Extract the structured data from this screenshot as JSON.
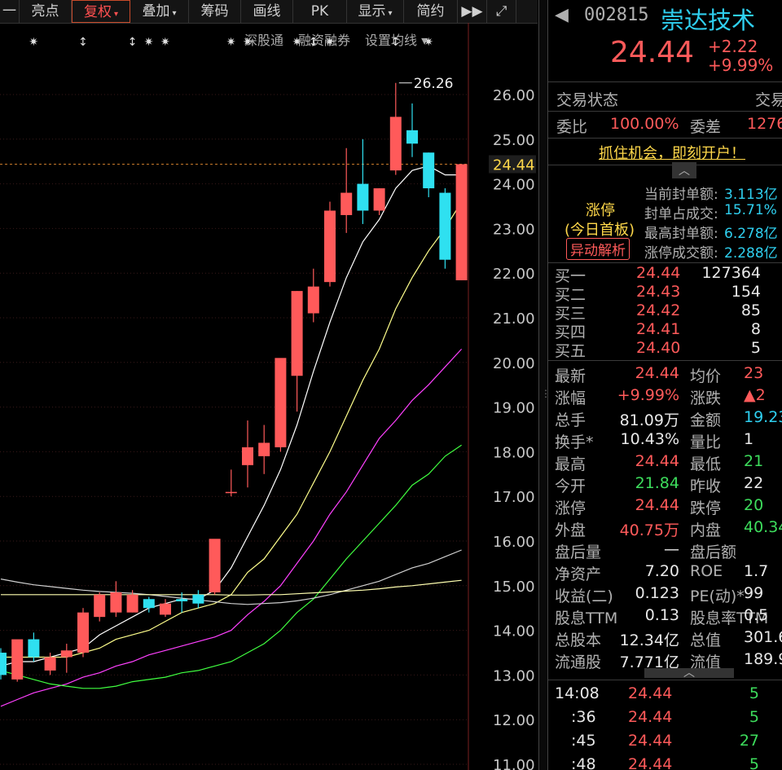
{
  "toolbar": {
    "items": [
      {
        "label": "一",
        "caret": ""
      },
      {
        "label": "亮点",
        "caret": ""
      },
      {
        "label": "复权",
        "caret": "▾"
      },
      {
        "label": "叠加",
        "caret": "▾"
      },
      {
        "label": "筹码",
        "caret": ""
      },
      {
        "label": "画线",
        "caret": ""
      },
      {
        "label": "PK",
        "caret": ""
      },
      {
        "label": "显示",
        "caret": "▾"
      },
      {
        "label": "简约",
        "caret": ""
      },
      {
        "label": "▶▶",
        "caret": ""
      },
      {
        "label": "⤢",
        "caret": ""
      }
    ]
  },
  "subbar": {
    "link1": "深股通",
    "link2": "融资融券",
    "link3": "设置均线 ▾"
  },
  "chart_data": {
    "type": "candlestick",
    "ylim": [
      11,
      27.2
    ],
    "y_ticks": [
      "26.00",
      "25.00",
      "24.00",
      "23.00",
      "22.00",
      "21.00",
      "20.00",
      "19.00",
      "18.00",
      "17.00",
      "16.00",
      "15.00",
      "14.00",
      "13.00",
      "12.00",
      "11.00"
    ],
    "current_price_label": "24.44",
    "max_label": "26.26",
    "candles": [
      {
        "o": 13.5,
        "h": 13.6,
        "l": 12.9,
        "c": 13.0
      },
      {
        "o": 12.9,
        "h": 13.6,
        "l": 12.85,
        "c": 13.8
      },
      {
        "o": 13.8,
        "h": 13.95,
        "l": 13.3,
        "c": 13.4
      },
      {
        "o": 13.1,
        "h": 13.5,
        "l": 13.0,
        "c": 13.4
      },
      {
        "o": 13.4,
        "h": 13.7,
        "l": 13.05,
        "c": 13.55
      },
      {
        "o": 13.5,
        "h": 14.5,
        "l": 13.4,
        "c": 14.4
      },
      {
        "o": 14.3,
        "h": 14.85,
        "l": 14.2,
        "c": 14.8
      },
      {
        "o": 14.4,
        "h": 15.1,
        "l": 14.3,
        "c": 14.85
      },
      {
        "o": 14.4,
        "h": 14.9,
        "l": 14.4,
        "c": 14.8
      },
      {
        "o": 14.7,
        "h": 14.75,
        "l": 14.4,
        "c": 14.5
      },
      {
        "o": 14.35,
        "h": 14.7,
        "l": 14.3,
        "c": 14.6
      },
      {
        "o": 14.7,
        "h": 14.85,
        "l": 14.4,
        "c": 14.65
      },
      {
        "o": 14.8,
        "h": 14.9,
        "l": 14.5,
        "c": 14.6
      },
      {
        "o": 14.85,
        "h": 16.0,
        "l": 14.8,
        "c": 16.05
      },
      {
        "o": 17.1,
        "h": 17.6,
        "l": 17.0,
        "c": 17.1
      },
      {
        "o": 17.7,
        "h": 18.7,
        "l": 17.2,
        "c": 18.1
      },
      {
        "o": 17.9,
        "h": 18.6,
        "l": 17.5,
        "c": 18.2
      },
      {
        "o": 18.1,
        "h": 18.5,
        "l": 18.0,
        "c": 20.1
      },
      {
        "o": 19.7,
        "h": 21.6,
        "l": 18.9,
        "c": 21.6
      },
      {
        "o": 21.1,
        "h": 22.1,
        "l": 20.9,
        "c": 21.7
      },
      {
        "o": 21.8,
        "h": 23.6,
        "l": 21.7,
        "c": 23.4
      },
      {
        "o": 23.3,
        "h": 24.8,
        "l": 22.9,
        "c": 23.8
      },
      {
        "o": 24.0,
        "h": 25.0,
        "l": 23.1,
        "c": 23.4
      },
      {
        "o": 23.4,
        "h": 23.9,
        "l": 23.3,
        "c": 23.9
      },
      {
        "o": 24.3,
        "h": 26.26,
        "l": 24.2,
        "c": 25.5
      },
      {
        "o": 25.2,
        "h": 25.8,
        "l": 24.6,
        "c": 24.9
      },
      {
        "o": 24.7,
        "h": 24.7,
        "l": 23.7,
        "c": 23.9
      },
      {
        "o": 23.8,
        "h": 23.9,
        "l": 22.1,
        "c": 22.3
      },
      {
        "o": 21.84,
        "h": 24.44,
        "l": 21.84,
        "c": 24.44
      }
    ],
    "ma_lines": [
      {
        "color": "#ffffff",
        "values": [
          13.2,
          13.3,
          13.3,
          13.4,
          13.5,
          13.6,
          13.9,
          14.1,
          14.3,
          14.5,
          14.6,
          14.7,
          14.7,
          14.9,
          15.4,
          16.1,
          16.8,
          17.6,
          18.6,
          19.8,
          20.9,
          21.9,
          22.7,
          23.2,
          23.9,
          24.3,
          24.4,
          24.2,
          24.2
        ]
      },
      {
        "color": "#ffff8c",
        "values": [
          13.4,
          13.4,
          13.4,
          13.4,
          13.4,
          13.5,
          13.6,
          13.8,
          13.9,
          14.0,
          14.2,
          14.4,
          14.5,
          14.6,
          14.8,
          15.3,
          15.6,
          16.1,
          16.6,
          17.3,
          18.0,
          18.8,
          19.6,
          20.3,
          21.2,
          21.9,
          22.5,
          23.0,
          23.6
        ]
      },
      {
        "color": "#ff40ff",
        "values": [
          12.3,
          12.45,
          12.6,
          12.7,
          12.8,
          12.95,
          13.05,
          13.2,
          13.3,
          13.45,
          13.55,
          13.65,
          13.75,
          13.85,
          14.0,
          14.35,
          14.65,
          15.0,
          15.5,
          16.0,
          16.6,
          17.1,
          17.7,
          18.3,
          18.7,
          19.15,
          19.5,
          19.9,
          20.3
        ]
      },
      {
        "color": "#40ff40",
        "values": [
          13.1,
          13.0,
          12.9,
          12.8,
          12.75,
          12.7,
          12.7,
          12.75,
          12.85,
          12.9,
          12.95,
          13.05,
          13.1,
          13.2,
          13.3,
          13.5,
          13.7,
          14.0,
          14.4,
          14.7,
          15.15,
          15.6,
          16.0,
          16.4,
          16.8,
          17.25,
          17.5,
          17.9,
          18.15
        ]
      },
      {
        "color": "#d0d0d0",
        "values": [
          15.15,
          15.08,
          15.02,
          14.98,
          14.94,
          14.9,
          14.87,
          14.85,
          14.83,
          14.8,
          14.76,
          14.72,
          14.68,
          14.64,
          14.6,
          14.58,
          14.6,
          14.62,
          14.66,
          14.72,
          14.8,
          14.9,
          15.0,
          15.1,
          15.25,
          15.4,
          15.5,
          15.65,
          15.8
        ]
      },
      {
        "color": "#ffffb0",
        "values": [
          14.8,
          14.8,
          14.8,
          14.8,
          14.8,
          14.8,
          14.8,
          14.8,
          14.8,
          14.8,
          14.8,
          14.8,
          14.8,
          14.8,
          14.79,
          14.79,
          14.8,
          14.8,
          14.82,
          14.84,
          14.86,
          14.88,
          14.9,
          14.93,
          14.97,
          15.0,
          15.04,
          15.08,
          15.12
        ]
      }
    ],
    "marker_slots": [
      {
        "i": 2,
        "sym": "✷"
      },
      {
        "i": 5,
        "sym": "↕"
      },
      {
        "i": 8,
        "sym": "↕"
      },
      {
        "i": 9,
        "sym": "✷"
      },
      {
        "i": 10,
        "sym": "✷"
      },
      {
        "i": 14,
        "sym": "✷"
      },
      {
        "i": 15,
        "sym": "✷"
      },
      {
        "i": 18,
        "sym": "✷"
      },
      {
        "i": 19,
        "sym": "↕"
      },
      {
        "i": 20,
        "sym": "✷"
      },
      {
        "i": 24,
        "sym": "↕"
      },
      {
        "i": 26,
        "sym": "✷"
      }
    ]
  },
  "header": {
    "code": "002815",
    "name": "崇达技术",
    "price": "24.44",
    "change": "+2.22",
    "change_pct": "+9.99%"
  },
  "status": {
    "label": "交易状态",
    "value": "交易"
  },
  "weibi": {
    "label1": "委比",
    "value1": "100.00%",
    "label2": "委差",
    "value2": "1276"
  },
  "promo": "抓住机会，即刻开户！",
  "limit_up": {
    "title": "涨停",
    "subtitle": "(今日首板)",
    "button": "异动解析",
    "rows": [
      {
        "label": "当前封单额:",
        "value": "3.113亿"
      },
      {
        "label": "封单占成交:",
        "value": "15.71%"
      },
      {
        "label": "最高封单额:",
        "value": "6.278亿"
      },
      {
        "label": "涨停成交额:",
        "value": "2.288亿"
      }
    ]
  },
  "bids": [
    {
      "label": "买一",
      "price": "24.44",
      "vol": "127364"
    },
    {
      "label": "买二",
      "price": "24.43",
      "vol": "154"
    },
    {
      "label": "买三",
      "price": "24.42",
      "vol": "85"
    },
    {
      "label": "买四",
      "price": "24.41",
      "vol": "8"
    },
    {
      "label": "买五",
      "price": "24.40",
      "vol": "5"
    }
  ],
  "quote": [
    {
      "l1": "最新",
      "v1": "24.44",
      "c1": "red",
      "l2": "均价",
      "v2": "23",
      "c2": "red"
    },
    {
      "l1": "涨幅",
      "v1": "+9.99%",
      "c1": "red",
      "l2": "涨跌",
      "v2": "▲2",
      "c2": "red"
    },
    {
      "l1": "总手",
      "v1": "81.09万",
      "c1": "white",
      "l2": "金额",
      "v2": "19.23",
      "c2": "cyan"
    },
    {
      "l1": "换手*",
      "v1": "10.43%",
      "c1": "white",
      "l2": "量比",
      "v2": "1",
      "c2": "white"
    },
    {
      "l1": "最高",
      "v1": "24.44",
      "c1": "red",
      "l2": "最低",
      "v2": "21",
      "c2": "green"
    },
    {
      "l1": "今开",
      "v1": "21.84",
      "c1": "green",
      "l2": "昨收",
      "v2": "22",
      "c2": "white"
    },
    {
      "l1": "涨停",
      "v1": "24.44",
      "c1": "red",
      "l2": "跌停",
      "v2": "20",
      "c2": "green"
    },
    {
      "l1": "外盘",
      "v1": "40.75万",
      "c1": "red",
      "l2": "内盘",
      "v2": "40.34",
      "c2": "green"
    },
    {
      "l1": "盘后量",
      "v1": "—",
      "c1": "white",
      "l2": "盘后额",
      "v2": "",
      "c2": "white"
    },
    {
      "l1": "净资产",
      "v1": "7.20",
      "c1": "white",
      "l2": "ROE",
      "v2": "1.7",
      "c2": "white"
    },
    {
      "l1": "收益(二)",
      "v1": "0.123",
      "c1": "white",
      "l2": "PE(动)*",
      "v2": "99",
      "c2": "white"
    },
    {
      "l1": "股息TTM",
      "v1": "0.13",
      "c1": "white",
      "l2": "股息率TTM",
      "v2": "0.5",
      "c2": "white"
    },
    {
      "l1": "总股本",
      "v1": "12.34亿",
      "c1": "white",
      "l2": "总值",
      "v2": "301.6",
      "c2": "white"
    },
    {
      "l1": "流通股",
      "v1": "7.771亿",
      "c1": "white",
      "l2": "流值",
      "v2": "189.9",
      "c2": "white"
    }
  ],
  "ticks": [
    {
      "time": "14:08",
      "price": "24.44",
      "vol": "5"
    },
    {
      "time": ":36",
      "price": "24.44",
      "vol": "5"
    },
    {
      "time": ":45",
      "price": "24.44",
      "vol": "27"
    },
    {
      "time": ":48",
      "price": "24.44",
      "vol": "5"
    }
  ]
}
